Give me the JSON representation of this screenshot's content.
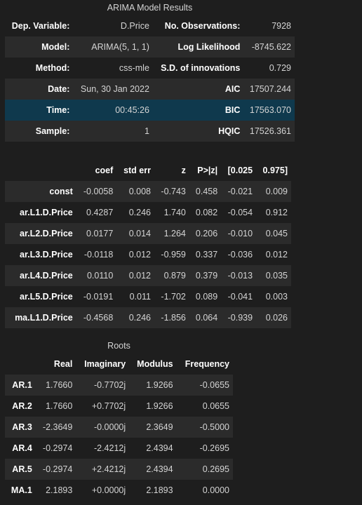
{
  "summary": {
    "caption": "ARIMA Model Results",
    "rows": [
      {
        "l1": "Dep. Variable:",
        "v1": "D.Price",
        "l2": "No. Observations:",
        "v2": "7928"
      },
      {
        "l1": "Model:",
        "v1": "ARIMA(5, 1, 1)",
        "l2": "Log Likelihood",
        "v2": "-8745.622"
      },
      {
        "l1": "Method:",
        "v1": "css-mle",
        "l2": "S.D. of innovations",
        "v2": "0.729"
      },
      {
        "l1": "Date:",
        "v1": "Sun, 30 Jan 2022",
        "l2": "AIC",
        "v2": "17507.244"
      },
      {
        "l1": "Time:",
        "v1": "00:45:26",
        "l2": "BIC",
        "v2": "17563.070"
      },
      {
        "l1": "Sample:",
        "v1": "1",
        "l2": "HQIC",
        "v2": "17526.361"
      }
    ]
  },
  "coefficients": {
    "headers": [
      "",
      "coef",
      "std err",
      "z",
      "P>|z|",
      "[0.025",
      "0.975]"
    ],
    "rows": [
      [
        "const",
        "-0.0058",
        "0.008",
        "-0.743",
        "0.458",
        "-0.021",
        "0.009"
      ],
      [
        "ar.L1.D.Price",
        "0.4287",
        "0.246",
        "1.740",
        "0.082",
        "-0.054",
        "0.912"
      ],
      [
        "ar.L2.D.Price",
        "0.0177",
        "0.014",
        "1.264",
        "0.206",
        "-0.010",
        "0.045"
      ],
      [
        "ar.L3.D.Price",
        "-0.0118",
        "0.012",
        "-0.959",
        "0.337",
        "-0.036",
        "0.012"
      ],
      [
        "ar.L4.D.Price",
        "0.0110",
        "0.012",
        "0.879",
        "0.379",
        "-0.013",
        "0.035"
      ],
      [
        "ar.L5.D.Price",
        "-0.0191",
        "0.011",
        "-1.702",
        "0.089",
        "-0.041",
        "0.003"
      ],
      [
        "ma.L1.D.Price",
        "-0.4568",
        "0.246",
        "-1.856",
        "0.064",
        "-0.939",
        "0.026"
      ]
    ]
  },
  "roots": {
    "caption": "Roots",
    "headers": [
      "",
      "Real",
      "Imaginary",
      "Modulus",
      "Frequency"
    ],
    "rows": [
      [
        "AR.1",
        "1.7660",
        "-0.7702j",
        "1.9266",
        "-0.0655"
      ],
      [
        "AR.2",
        "1.7660",
        "+0.7702j",
        "1.9266",
        "0.0655"
      ],
      [
        "AR.3",
        "-2.3649",
        "-0.0000j",
        "2.3649",
        "-0.5000"
      ],
      [
        "AR.4",
        "-0.2974",
        "-2.4212j",
        "2.4394",
        "-0.2695"
      ],
      [
        "AR.5",
        "-0.2974",
        "+2.4212j",
        "2.4394",
        "0.2695"
      ],
      [
        "MA.1",
        "2.1893",
        "+0.0000j",
        "2.1893",
        "0.0000"
      ]
    ]
  }
}
